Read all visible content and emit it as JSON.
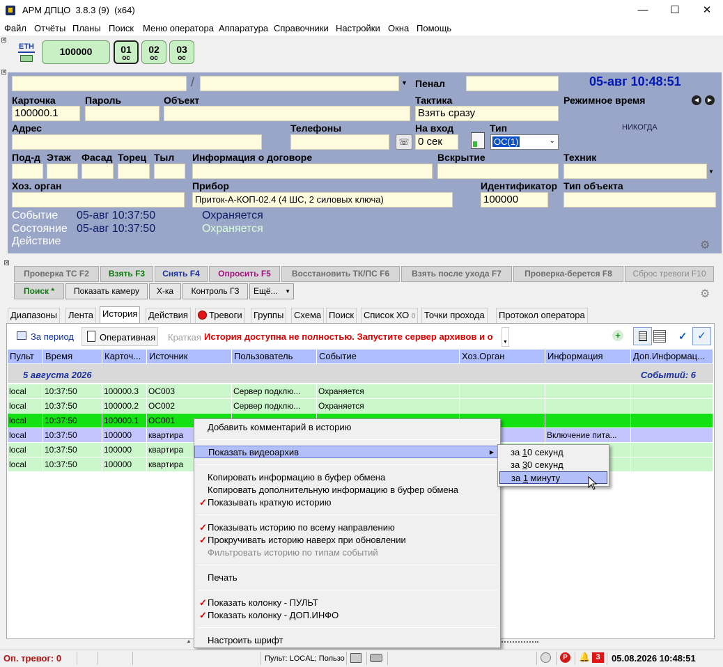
{
  "window": {
    "title": "АРМ ДПЦО  3.8.3 (9)  (x64)",
    "minimize": "—",
    "maximize": "☐",
    "close": "✕"
  },
  "menu": [
    "Файл",
    "Отчёты",
    "Планы",
    "Поиск",
    "Меню оператора",
    "Аппаратура",
    "Справочники",
    "Настройки",
    "Окна",
    "Помощь"
  ],
  "toolbar": {
    "eth_label": "ETH",
    "account_button": "100000",
    "partitions": [
      {
        "num": "01",
        "sub": "ос"
      },
      {
        "num": "02",
        "sub": "ос"
      },
      {
        "num": "03",
        "sub": "ос"
      }
    ]
  },
  "card": {
    "top_field1": "",
    "separator": "/",
    "top_field2": "",
    "penal_label": "Пенал",
    "penal_value": "",
    "datetime": "05-авг 10:48:51",
    "card_label": "Карточка",
    "card_value": "100000.1",
    "password_label": "Пароль",
    "password_value": "",
    "object_label": "Объект",
    "object_value": "",
    "tactic_label": "Тактика",
    "tactic_value": "Взять сразу",
    "mode_time_label": "Режимное время",
    "mode_time_value": "НИКОГДА",
    "address_label": "Адрес",
    "address_value": "",
    "phones_label": "Телефоны",
    "phones_value": "",
    "entry_label": "На вход",
    "entry_value": "0 сек",
    "type_label": "Тип",
    "type_value": "ОС(1)",
    "entrance_label": "Под-д",
    "floor_label": "Этаж",
    "facade_label": "Фасад",
    "end_label": "Торец",
    "rear_label": "Тыл",
    "contract_label": "Информация о договоре",
    "opening_label": "Вскрытие",
    "technician_label": "Техник",
    "owner_label": "Хоз. орган",
    "device_label": "Прибор",
    "device_value": "Приток-А-КОП-02.4 (4 ШС, 2 силовых ключа)",
    "id_label": "Идентификатор",
    "id_value": "100000",
    "object_type_label": "Тип объекта",
    "event_label": "Событие",
    "event_time": "05-авг 10:37:50",
    "event_text": "Охраняется",
    "state_label": "Состояние",
    "state_time": "05-авг 10:37:50",
    "state_text": "Охраняется",
    "action_label": "Действие"
  },
  "buttons_row1": [
    {
      "label": "Проверка ТС F2",
      "color": "#6d6d6d"
    },
    {
      "label": "Взять F3",
      "color": "#0e7a0e"
    },
    {
      "label": "Снять F4",
      "color": "#1a2f9a"
    },
    {
      "label": "Опросить F5",
      "color": "#a3127d"
    },
    {
      "label": "Восстановить ТК/ПС F6",
      "color": "#6d6d6d"
    },
    {
      "label": "Взять после ухода F7",
      "color": "#6d6d6d"
    },
    {
      "label": "Проверка-берется F8",
      "color": "#6d6d6d"
    },
    {
      "label": "Сброс тревоги F10",
      "color": "#8a8a8a"
    }
  ],
  "buttons_row2": {
    "search": "Поиск *",
    "show_camera": "Показать камеру",
    "xka": "Х-ка",
    "control": "Контроль ГЗ",
    "more": "Ещё..."
  },
  "tabs": [
    "Диапазоны",
    "Лента",
    "История",
    "Действия",
    "Тревоги",
    "Группы",
    "Схема",
    "Поиск",
    "Список ХО",
    "Точки прохода",
    "Протокол оператора"
  ],
  "tabs_extra": {
    "hozorg_count": "0"
  },
  "history_toolbar": {
    "period": "За период",
    "operative": "Оперативная",
    "brief": "Краткая",
    "warning": "История доступна не полностью. Запустите сервер архивов и о"
  },
  "table": {
    "columns": [
      "Пульт",
      "Время",
      "Карточ...",
      "Источник",
      "Пользователь",
      "Событие",
      "Хоз.Орган",
      "Информация",
      "Доп.Информац..."
    ],
    "group_date": "5 августа 2026",
    "group_count": "Событий: 6",
    "rows": [
      {
        "cells": [
          "local",
          "10:37:50",
          "100000.3",
          "ОС003",
          "Сервер подклю...",
          "Охраняется",
          "",
          "",
          ""
        ],
        "bg": "#ccf7cc"
      },
      {
        "cells": [
          "local",
          "10:37:50",
          "100000.2",
          "ОС002",
          "Сервер подклю...",
          "Охраняется",
          "",
          "",
          ""
        ],
        "bg": "#ccf7cc"
      },
      {
        "cells": [
          "local",
          "10:37:50",
          "100000.1",
          "ОС001",
          "",
          "",
          "",
          "",
          ""
        ],
        "bg": "#13e113"
      },
      {
        "cells": [
          "local",
          "10:37:50",
          "100000",
          "квартира",
          "",
          "",
          "",
          "Включение пита...",
          ""
        ],
        "bg": "#c4c4ff"
      },
      {
        "cells": [
          "local",
          "10:37:50",
          "100000",
          "квартира",
          "",
          "",
          "",
          "",
          ""
        ],
        "bg": "#ccf7cc"
      },
      {
        "cells": [
          "local",
          "10:37:50",
          "100000",
          "квартира",
          "",
          "",
          "",
          "",
          ""
        ],
        "bg": "#ccf7cc"
      }
    ]
  },
  "context_menu": {
    "add_comment": "Добавить комментарий в историю",
    "show_video": "Показать видеоархив",
    "copy_info": "Копировать информацию в буфер обмена",
    "copy_extra": "Копировать дополнительную информацию в буфер обмена",
    "show_brief": "Показывать краткую историю",
    "show_direction": "Показывать историю по всему направлению",
    "scroll_up": "Прокручивать историю наверх при обновлении",
    "filter": "Фильтровать историю по типам событий",
    "print": "Печать",
    "col_pult": "Показать колонку - ПУЛЬТ",
    "col_dop": "Показать колонку - ДОП.ИНФО",
    "font": "Настроить шрифт",
    "check_mark": "✓"
  },
  "submenu": {
    "pre": "за ",
    "item1_key": "1",
    "item1_rest": "0 секунд",
    "item2_key": "3",
    "item2_rest": "0 секунд",
    "item3_key": "1",
    "item3_rest": " минуту"
  },
  "status": {
    "alarms": "Оп. тревог: 0",
    "pult": "Пульт: LOCAL; Пользо",
    "p_badge": "P",
    "alarm_count": "3",
    "datetime": "05.08.2026 10:48:51"
  }
}
